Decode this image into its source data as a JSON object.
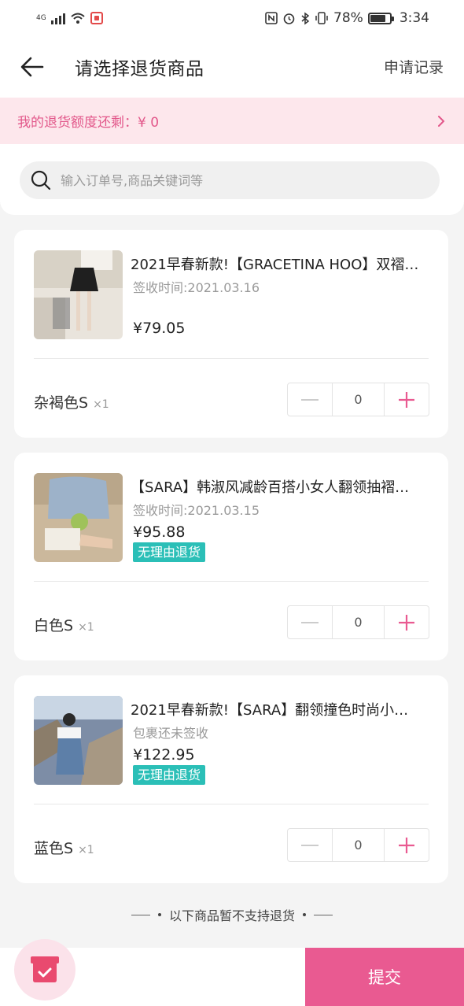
{
  "status_bar": {
    "network_label": "4G",
    "battery_text": "78%",
    "time": "3:34",
    "icons": [
      "signal-icon",
      "wifi-icon",
      "app-notification-icon",
      "nfc-icon",
      "alarm-icon",
      "bluetooth-icon",
      "vibrate-icon",
      "battery-icon"
    ]
  },
  "header": {
    "title": "请选择退货商品",
    "records_label": "申请记录"
  },
  "quota": {
    "text": "我的退货额度还剩：¥ 0"
  },
  "search": {
    "placeholder": "输入订单号,商品关键词等"
  },
  "items": [
    {
      "name": "2021早春新款!【GRACETINA HOO】双褶…",
      "status": "签收时间:2021.03.16",
      "price": "¥79.05",
      "tag": "",
      "sku": "杂褐色S",
      "qty": "×1",
      "stepper_value": "0"
    },
    {
      "name": "【SARA】韩淑风减龄百搭小女人翻领抽褶…",
      "status": "签收时间:2021.03.15",
      "price": "¥95.88",
      "tag": "无理由退货",
      "sku": "白色S",
      "qty": "×1",
      "stepper_value": "0"
    },
    {
      "name": "2021早春新款!【SARA】翻领撞色时尚小…",
      "status": "包裹还未签收",
      "price": "¥122.95",
      "tag": "无理由退货",
      "sku": "蓝色S",
      "qty": "×1",
      "stepper_value": "0"
    }
  ],
  "notice": {
    "text": "以下商品暂不支持退货"
  },
  "footer": {
    "submit_label": "提交"
  },
  "colors": {
    "accent": "#e95a91",
    "banner_bg": "#fde7ec",
    "tag_bg": "#2bbfb7"
  }
}
